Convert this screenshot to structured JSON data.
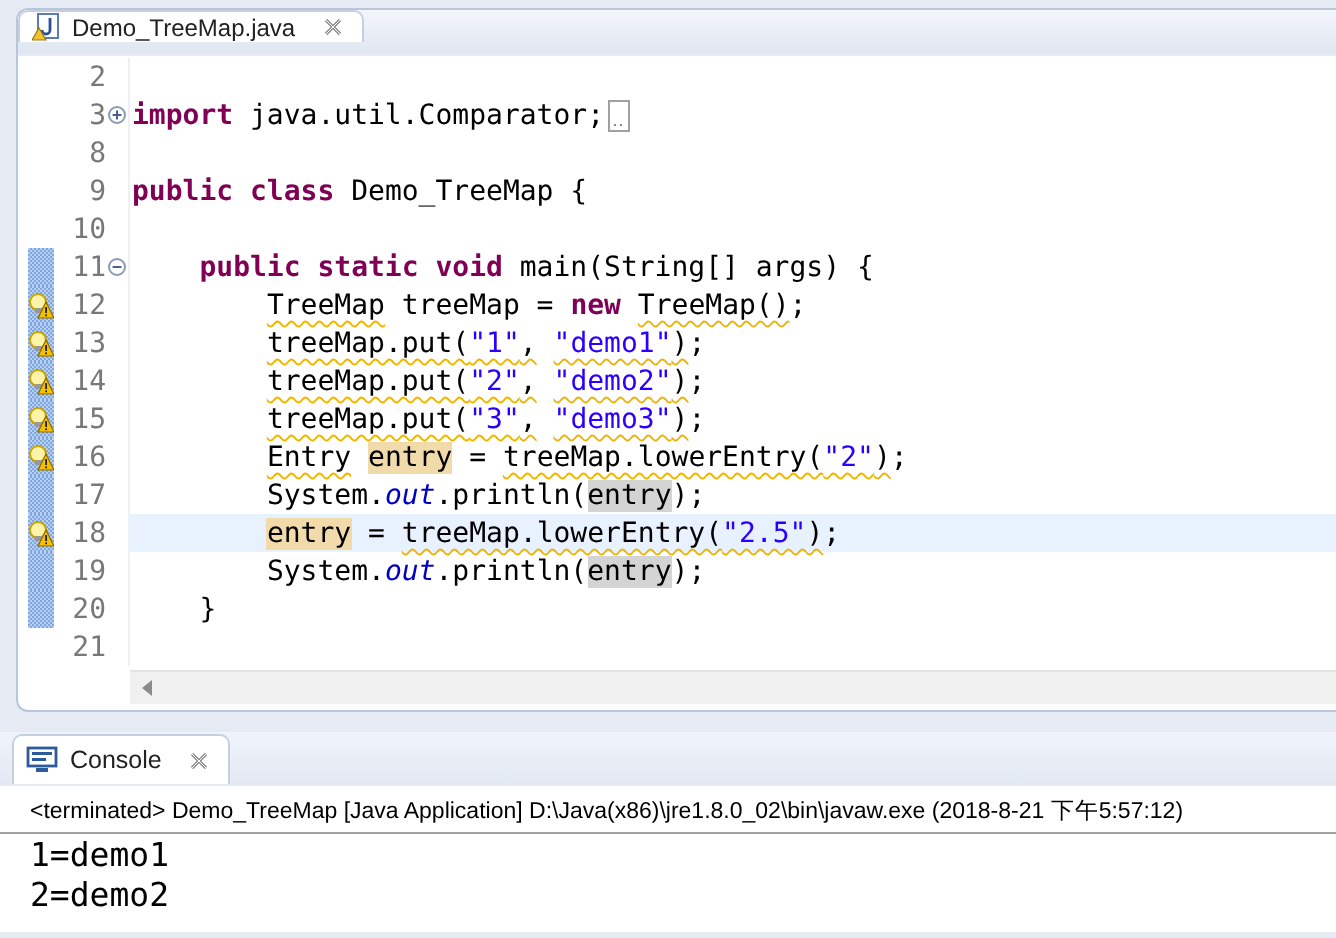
{
  "editor": {
    "tab": {
      "title": "Demo_TreeMap.java",
      "selected": true
    },
    "lines": [
      {
        "number": "2",
        "current": false,
        "warning": false,
        "changed": false
      },
      {
        "number": "3",
        "current": false,
        "warning": false,
        "changed": false,
        "expanded": false,
        "tokens": [
          {
            "text": "import",
            "kind": "keyword",
            "warned": false
          },
          {
            "text": " java.util.Comparator;",
            "kind": "plain",
            "warned": false
          }
        ]
      },
      {
        "number": "8",
        "current": false,
        "warning": false,
        "changed": false
      },
      {
        "number": "9",
        "current": false,
        "warning": false,
        "changed": false,
        "tokens": [
          {
            "text": "public class",
            "kind": "keyword",
            "warned": false
          },
          {
            "text": " Demo_TreeMap {",
            "kind": "plain",
            "warned": false
          }
        ]
      },
      {
        "number": "10",
        "current": false,
        "warning": false,
        "changed": false
      },
      {
        "number": "11",
        "current": false,
        "warning": false,
        "changed": true,
        "expanded": true,
        "tokens": [
          {
            "text": "    public static void",
            "kind": "keyword",
            "warned": false
          },
          {
            "text": " main(String[] args) {",
            "kind": "plain",
            "warned": false
          }
        ]
      },
      {
        "number": "12",
        "current": false,
        "warning": true,
        "changed": true,
        "tokens": [
          {
            "text": "        TreeMap",
            "kind": "plain",
            "warned": true
          },
          {
            "text": " treeMap = ",
            "kind": "plain",
            "warned": false
          },
          {
            "text": "new ",
            "kind": "keyword",
            "warned": false
          },
          {
            "text": "TreeMap()",
            "kind": "plain",
            "warned": true
          },
          {
            "text": ";",
            "kind": "plain",
            "warned": false
          }
        ]
      },
      {
        "number": "13",
        "current": false,
        "warning": true,
        "changed": true,
        "tokens": [
          {
            "text": "        treeMap.put(",
            "kind": "plain",
            "warned": true
          },
          {
            "text": "\"1\"",
            "kind": "string",
            "warned": true
          },
          {
            "text": ", ",
            "kind": "plain",
            "warned": true
          },
          {
            "text": "\"demo1\"",
            "kind": "string",
            "warned": true
          },
          {
            "text": ")",
            "kind": "plain",
            "warned": true
          },
          {
            "text": ";",
            "kind": "plain",
            "warned": false
          }
        ]
      },
      {
        "number": "14",
        "current": false,
        "warning": true,
        "changed": true,
        "tokens": [
          {
            "text": "        treeMap.put(",
            "kind": "plain",
            "warned": true
          },
          {
            "text": "\"2\"",
            "kind": "string",
            "warned": true
          },
          {
            "text": ", ",
            "kind": "plain",
            "warned": true
          },
          {
            "text": "\"demo2\"",
            "kind": "string",
            "warned": true
          },
          {
            "text": ")",
            "kind": "plain",
            "warned": true
          },
          {
            "text": ";",
            "kind": "plain",
            "warned": false
          }
        ]
      },
      {
        "number": "15",
        "current": false,
        "warning": true,
        "changed": true,
        "tokens": [
          {
            "text": "        treeMap.put(",
            "kind": "plain",
            "warned": true
          },
          {
            "text": "\"3\"",
            "kind": "string",
            "warned": true
          },
          {
            "text": ", ",
            "kind": "plain",
            "warned": true
          },
          {
            "text": "\"demo3\"",
            "kind": "string",
            "warned": true
          },
          {
            "text": ")",
            "kind": "plain",
            "warned": true
          },
          {
            "text": ";",
            "kind": "plain",
            "warned": false
          }
        ]
      },
      {
        "number": "16",
        "current": false,
        "warning": true,
        "changed": true,
        "tokens": [
          {
            "text": "        Entry ",
            "kind": "plain",
            "warned": true
          },
          {
            "text": "entry",
            "kind": "written",
            "warned": false
          },
          {
            "text": " = ",
            "kind": "plain",
            "warned": false
          },
          {
            "text": "treeMap.lowerEntry(",
            "kind": "plain",
            "warned": true
          },
          {
            "text": "\"2\"",
            "kind": "string",
            "warned": true
          },
          {
            "text": ")",
            "kind": "plain",
            "warned": true
          },
          {
            "text": ";",
            "kind": "plain",
            "warned": false
          }
        ]
      },
      {
        "number": "17",
        "current": false,
        "warning": false,
        "changed": true,
        "tokens": [
          {
            "text": "        System.",
            "kind": "plain",
            "warned": false
          },
          {
            "text": "out",
            "kind": "field",
            "warned": false
          },
          {
            "text": ".println(",
            "kind": "plain",
            "warned": false
          },
          {
            "text": "entry",
            "kind": "read",
            "warned": false
          },
          {
            "text": ");",
            "kind": "plain",
            "warned": false
          }
        ]
      },
      {
        "number": "18",
        "current": true,
        "warning": true,
        "changed": true,
        "tokens": [
          {
            "text": "        entry",
            "kind": "written",
            "warned": false
          },
          {
            "text": " = ",
            "kind": "plain",
            "warned": false
          },
          {
            "text": "treeMap.lowerEntry(",
            "kind": "plain",
            "warned": true
          },
          {
            "text": "\"2.5\"",
            "kind": "string",
            "warned": true
          },
          {
            "text": ")",
            "kind": "plain",
            "warned": true
          },
          {
            "text": ";",
            "kind": "plain",
            "warned": false
          }
        ]
      },
      {
        "number": "19",
        "current": false,
        "warning": false,
        "changed": true,
        "tokens": [
          {
            "text": "        System.",
            "kind": "plain",
            "warned": false
          },
          {
            "text": "out",
            "kind": "field",
            "warned": false
          },
          {
            "text": ".println(",
            "kind": "plain",
            "warned": false
          },
          {
            "text": "entry",
            "kind": "read",
            "warned": false
          },
          {
            "text": ");",
            "kind": "plain",
            "warned": false
          }
        ]
      },
      {
        "number": "20",
        "current": false,
        "warning": false,
        "changed": true,
        "tokens": [
          {
            "text": "    }",
            "kind": "plain",
            "warned": false
          }
        ]
      },
      {
        "number": "21",
        "current": false,
        "warning": false,
        "changed": false
      }
    ]
  },
  "console": {
    "tab": {
      "title": "Console",
      "selected": true
    },
    "status": "<terminated> Demo_TreeMap [Java Application] D:\\Java(x86)\\jre1.8.0_02\\bin\\javaw.exe (2018-8-21 下午5:57:12)",
    "output": [
      "1=demo1",
      "2=demo2"
    ]
  }
}
